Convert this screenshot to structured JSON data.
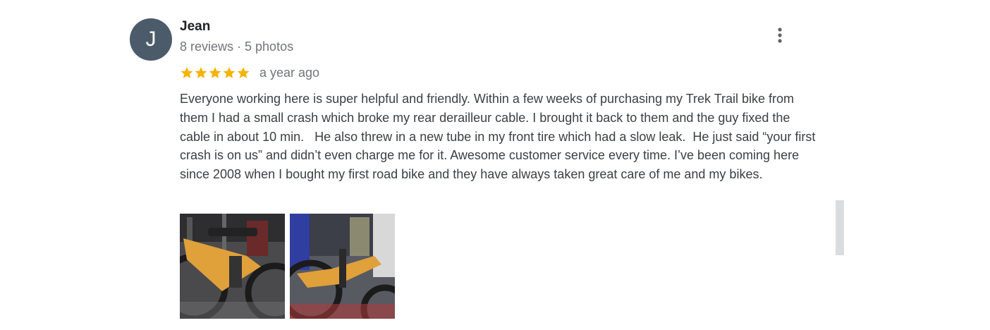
{
  "review": {
    "author_initial": "J",
    "author_name": "Jean",
    "author_meta": "8 reviews · 5 photos",
    "rating": 5,
    "rating_max": 5,
    "date": "a year ago",
    "text": "Everyone working here is super helpful and friendly. Within a few weeks of purchasing my Trek Trail bike from them I had a small crash which broke my rear derailleur cable. I brought it back to them and the guy fixed the cable in about 10 min.   He also threw in a new tube in my front tire which had a slow leak.  He just said “your first crash is on us” and didn’t even charge me for it. Awesome customer service every time. I’ve been coming here since 2008 when I bought my first road bike and they have always taken great care of me and my bikes.",
    "photo_count": 2,
    "more_icon": "more-vert-icon",
    "star_icon": "star-icon",
    "star_color": "#f4b400"
  },
  "colors": {
    "avatar_bg": "#4c5b6a",
    "text_primary": "#202124",
    "text_secondary": "#70757a",
    "scrollbar": "#dadce0"
  }
}
